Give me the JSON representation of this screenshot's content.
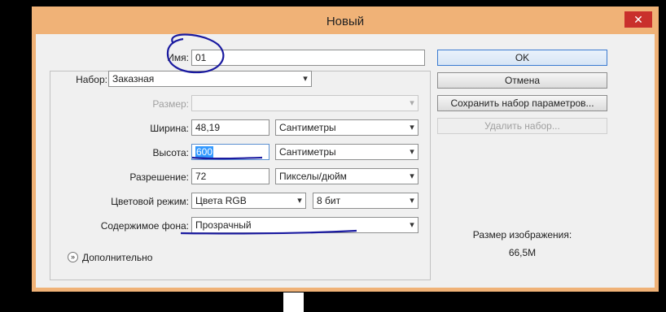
{
  "window": {
    "title": "Новый",
    "close_glyph": "✕"
  },
  "form": {
    "name_label": "Имя:",
    "name_value": "01",
    "preset_label": "Набор:",
    "preset_value": "Заказная",
    "size_label": "Размер:",
    "size_value": "",
    "width_label": "Ширина:",
    "width_value": "48,19",
    "width_unit": "Сантиметры",
    "height_label": "Высота:",
    "height_value": "600",
    "height_unit": "Сантиметры",
    "resolution_label": "Разрешение:",
    "resolution_value": "72",
    "resolution_unit": "Пикселы/дюйм",
    "color_mode_label": "Цветовой режим:",
    "color_mode_value": "Цвета RGB",
    "bit_depth_value": "8 бит",
    "background_label": "Содержимое фона:",
    "background_value": "Прозрачный",
    "advanced_label": "Дополнительно"
  },
  "buttons": {
    "ok": "OK",
    "cancel": "Отмена",
    "save_preset": "Сохранить набор параметров...",
    "delete_preset": "Удалить набор..."
  },
  "info": {
    "image_size_label": "Размер изображения:",
    "image_size_value": "66,5M"
  },
  "colors": {
    "window_frame": "#f0b277",
    "annotation_ink": "#1a1aa0",
    "selection": "#3399ff"
  }
}
